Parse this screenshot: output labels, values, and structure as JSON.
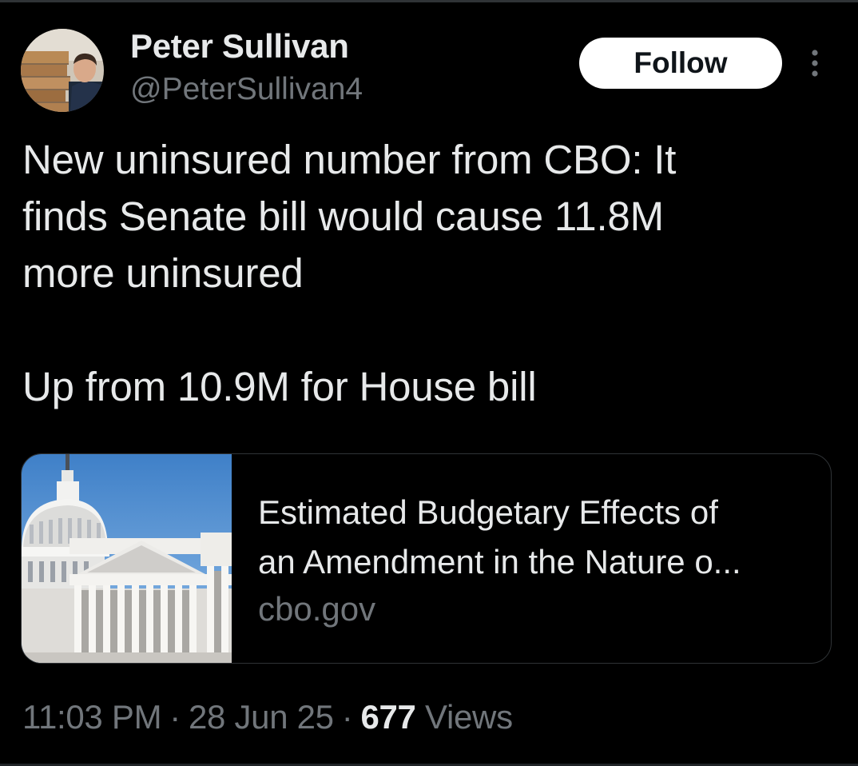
{
  "author": {
    "name": "Peter Sullivan",
    "handle": "@PeterSullivan4"
  },
  "follow_label": "Follow",
  "tweet": {
    "text": "New uninsured number from CBO: It\nfinds Senate bill would cause 11.8M\nmore uninsured\n\nUp from 10.9M for House bill"
  },
  "link_card": {
    "title_line1": "Estimated Budgetary Effects of",
    "title_line2": "an Amendment in the Nature o...",
    "domain": "cbo.gov",
    "image": "us-capitol-photo"
  },
  "meta": {
    "time": "11:03 PM",
    "separator": "·",
    "date": "28 Jun 25",
    "views_count": "677",
    "views_label": "Views"
  },
  "colors": {
    "background": "#000000",
    "text_primary": "#e7e9ea",
    "text_secondary": "#71767b",
    "follow_bg": "#ffffff",
    "card_border": "#2f3336"
  },
  "icons": {
    "more": "more-vertical-icon"
  }
}
